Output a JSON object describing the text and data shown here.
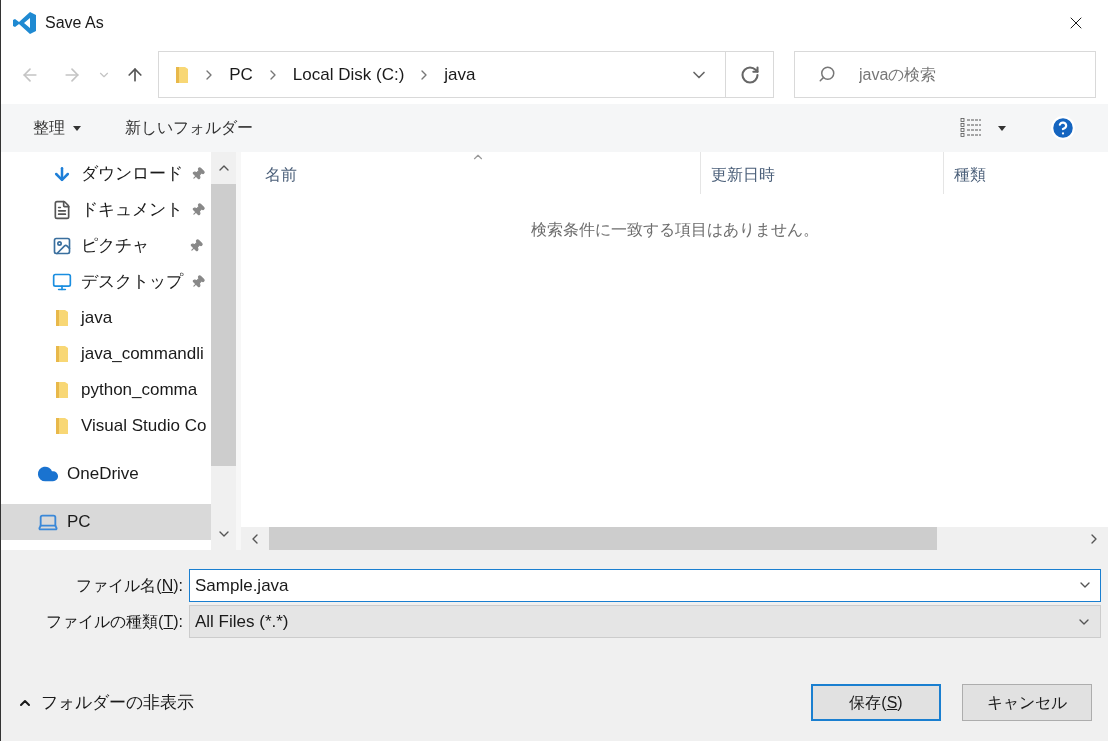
{
  "window": {
    "title": "Save As"
  },
  "address": {
    "crumbs": [
      "PC",
      "Local Disk (C:)",
      "java"
    ]
  },
  "search": {
    "placeholder": "javaの検索"
  },
  "toolbar": {
    "organize": "整理",
    "new_folder": "新しいフォルダー"
  },
  "sidebar": {
    "items": [
      {
        "kind": "download",
        "label": "ダウンロード",
        "pinned": true,
        "selected": false
      },
      {
        "kind": "document",
        "label": "ドキュメント",
        "pinned": true,
        "selected": false
      },
      {
        "kind": "image",
        "label": "ピクチャ",
        "pinned": true,
        "selected": false
      },
      {
        "kind": "desktop",
        "label": "デスクトップ",
        "pinned": true,
        "selected": false
      },
      {
        "kind": "folder",
        "label": "java",
        "selected": false
      },
      {
        "kind": "folder",
        "label": "java_commandli",
        "selected": false
      },
      {
        "kind": "folder",
        "label": "python_comma",
        "selected": false
      },
      {
        "kind": "folder",
        "label": "Visual Studio Co",
        "selected": false
      },
      {
        "kind": "cloud",
        "label": "OneDrive",
        "selected": false
      },
      {
        "kind": "pc",
        "label": "PC",
        "selected": true
      }
    ]
  },
  "table": {
    "columns": [
      "名前",
      "更新日時",
      "種類"
    ],
    "empty_message": "検索条件に一致する項目はありません。"
  },
  "file_name": {
    "label_before": "ファイル名(",
    "access_key": "N",
    "label_after": "):",
    "value": "Sample.java"
  },
  "file_type": {
    "label_before": "ファイルの種類(",
    "access_key": "T",
    "label_after": "):",
    "value": "All Files (*.*)"
  },
  "hide_folders": "フォルダーの非表示",
  "buttons": [
    {
      "label_before": "保存(",
      "access_key": "S",
      "label_after": ")",
      "default": true
    },
    {
      "label": "キャンセル",
      "default": false
    }
  ]
}
